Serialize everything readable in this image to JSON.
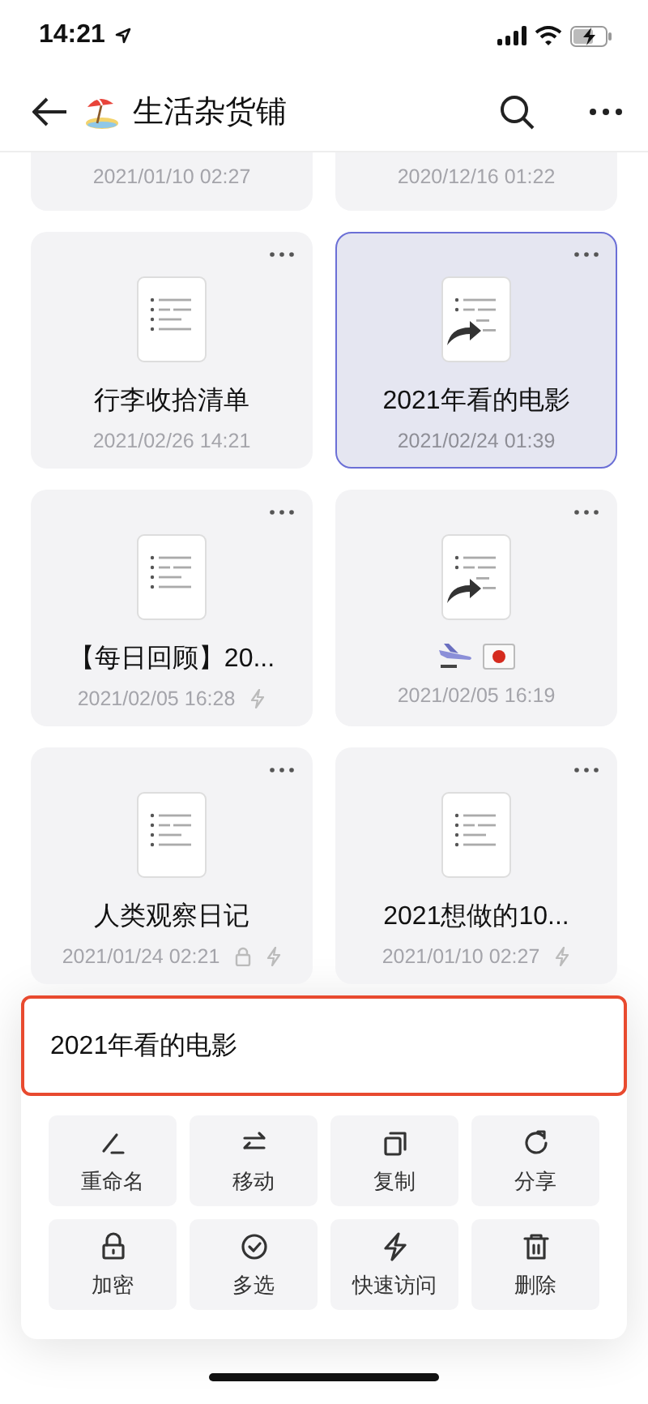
{
  "status_bar": {
    "time": "14:21"
  },
  "nav": {
    "title": "生活杂货铺"
  },
  "partial_cards": [
    {
      "date": "2021/01/10 02:27"
    },
    {
      "date": "2020/12/16 01:22"
    }
  ],
  "cards": [
    {
      "title": "行李收拾清单",
      "date": "2021/02/26 14:21",
      "selected": false,
      "shortcut": false,
      "locked": false,
      "quick_access": false
    },
    {
      "title": "2021年看的电影",
      "date": "2021/02/24 01:39",
      "selected": true,
      "shortcut": true,
      "locked": false,
      "quick_access": false
    },
    {
      "title": "【每日回顾】20...",
      "date": "2021/02/05 16:28",
      "selected": false,
      "shortcut": false,
      "locked": false,
      "quick_access": true
    },
    {
      "kind": "emoji_title",
      "date": "2021/02/05 16:19",
      "selected": false,
      "shortcut": true,
      "locked": false,
      "quick_access": false
    },
    {
      "title": "人类观察日记",
      "date": "2021/01/24 02:21",
      "selected": false,
      "shortcut": false,
      "locked": true,
      "quick_access": true
    },
    {
      "title": "2021想做的10...",
      "date": "2021/01/10 02:27",
      "selected": false,
      "shortcut": false,
      "locked": false,
      "quick_access": true
    }
  ],
  "sheet": {
    "name_value": "2021年看的电影",
    "actions": [
      {
        "kind": "rename",
        "label": "重命名"
      },
      {
        "kind": "move",
        "label": "移动"
      },
      {
        "kind": "copy",
        "label": "复制"
      },
      {
        "kind": "share",
        "label": "分享"
      },
      {
        "kind": "lock",
        "label": "加密"
      },
      {
        "kind": "multi",
        "label": "多选"
      },
      {
        "kind": "quick",
        "label": "快速访问"
      },
      {
        "kind": "delete",
        "label": "删除"
      }
    ]
  }
}
